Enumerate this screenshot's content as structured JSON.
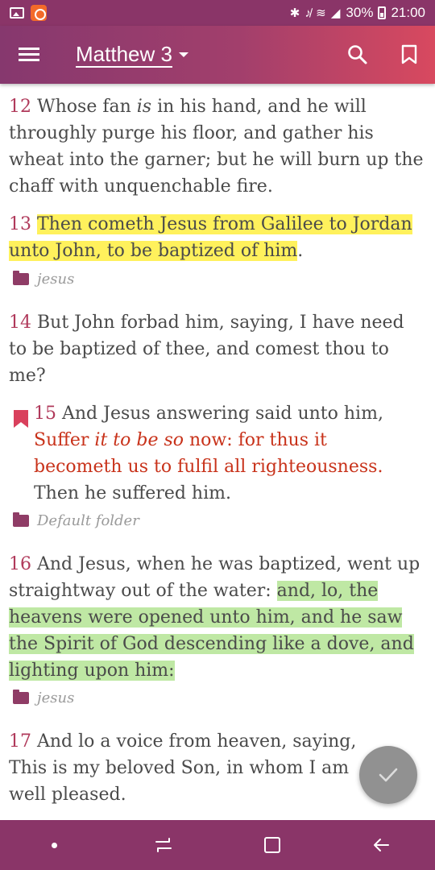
{
  "status": {
    "battery": "30%",
    "time": "21:00",
    "system_icons": "✱ ♪̸ ≋ ◢"
  },
  "app_bar": {
    "title": "Matthew 3"
  },
  "verses": [
    {
      "num": "12",
      "segments": [
        {
          "text": "Whose fan "
        },
        {
          "text": "is",
          "italic": true
        },
        {
          "text": " in his hand, and he will throughly purge his floor, and gather his wheat into the garner; but he will burn up the chaff with unquenchable fire."
        }
      ]
    },
    {
      "num": "13",
      "segments": [
        {
          "text": "Then cometh Jesus from Galilee to Jordan unto John, to be baptized of him",
          "highlight": "yellow"
        },
        {
          "text": "."
        }
      ],
      "folder": "jesus"
    },
    {
      "num": "14",
      "segments": [
        {
          "text": "But John forbad him, saying, I have need to be baptized of thee, and comest thou to me?"
        }
      ]
    },
    {
      "num": "15",
      "bookmarked": true,
      "segments": [
        {
          "text": "And Jesus answering said unto him, "
        },
        {
          "text": "Suffer ",
          "red": true
        },
        {
          "text": "it to be so",
          "red": true,
          "italic": true
        },
        {
          "text": " now: for thus it becometh us to fulfil all righteousness.",
          "red": true
        },
        {
          "text": " Then he suffered him."
        }
      ],
      "folder": "Default folder"
    },
    {
      "num": "16",
      "segments": [
        {
          "text": "And Jesus, when he was baptized, went up straightway out of the water: "
        },
        {
          "text": "and, lo, the heavens were opened unto him, and he saw the Spirit of God descending like a dove, and lighting upon him:",
          "highlight": "green"
        }
      ],
      "folder": "jesus"
    },
    {
      "num": "17",
      "segments": [
        {
          "text": "And lo a voice from heaven, saying, This is my beloved Son, in whom I am well pleased."
        }
      ]
    }
  ],
  "colors": {
    "primary": "#8a3568",
    "accent": "#d8495f",
    "verse_number": "#b03a5b",
    "red_letter": "#c8321a",
    "highlight_yellow": "#fff15c",
    "highlight_green": "#bfe8a4"
  },
  "icons": {
    "menu": "menu-icon",
    "dropdown": "chevron-down-icon",
    "search": "search-icon",
    "bookmark": "bookmark-icon",
    "folder": "folder-icon",
    "fab": "check-icon",
    "nav": [
      "dot-icon",
      "recents-icon",
      "home-icon",
      "back-icon"
    ]
  }
}
